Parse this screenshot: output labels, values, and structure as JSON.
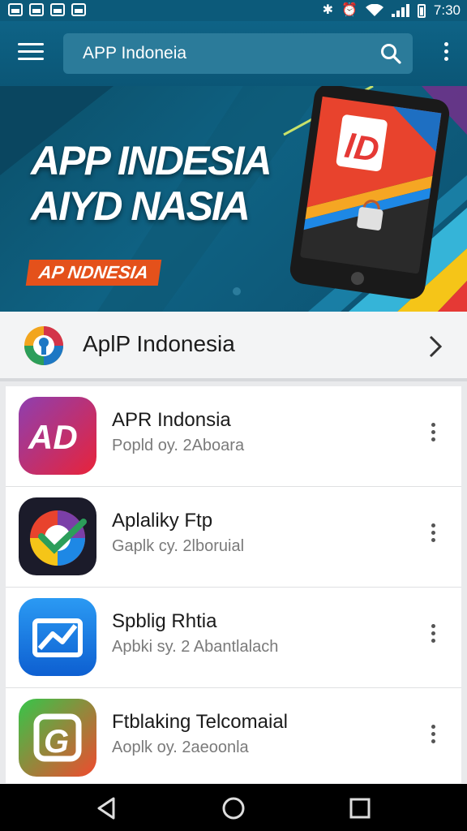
{
  "status_bar": {
    "time": "7:30",
    "left_icons": [
      "image-icon",
      "image-icon",
      "screenshot-icon",
      "photo-icon"
    ],
    "right_icons": [
      "bluetooth-icon",
      "alarm-icon",
      "wifi-icon",
      "signal-icon",
      "battery-icon"
    ]
  },
  "app_bar": {
    "search_value": "APP Indoneia",
    "icons": [
      "menu-icon",
      "search-icon",
      "more-vert-icon"
    ]
  },
  "banner": {
    "title_line1": "APP INDESIA",
    "title_line2": "AIYD NASIA",
    "tag": "AP NDNESIA"
  },
  "featured": {
    "title": "AplP Indonesia",
    "icons": [
      "app-logo-icon",
      "chevron-right-icon"
    ]
  },
  "apps": [
    {
      "title": "APR Indonsia",
      "subtitle": "Popld oy. 2Aboara",
      "icon": "app-icon-ad"
    },
    {
      "title": "Aplaliky Ftp",
      "subtitle": "Gaplk cy. 2lboruial",
      "icon": "app-icon-check"
    },
    {
      "title": "Spblig Rhtia",
      "subtitle": "Apbki sy. 2 Abantlalach",
      "icon": "app-icon-chart"
    },
    {
      "title": "Ftblaking Telcomaial",
      "subtitle": "Aoplk oy. 2aeoonla",
      "icon": "app-icon-g"
    }
  ],
  "nav": {
    "icons": [
      "back-icon",
      "home-icon",
      "recents-icon"
    ]
  },
  "colors": {
    "app_bar": "#0e6386",
    "search_box": "#2b7b9a",
    "banner_tag": "#e4511b"
  }
}
